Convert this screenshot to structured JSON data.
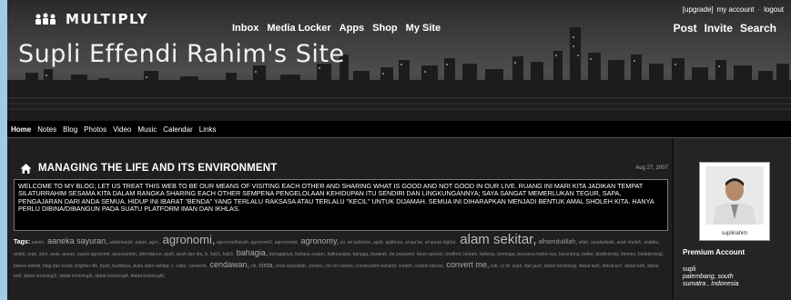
{
  "header": {
    "logo_text": "MULTIPLY",
    "site_title": "Supli Effendi Rahim's Site",
    "top_nav": [
      "Inbox",
      "Media Locker",
      "Apps",
      "Shop",
      "My Site"
    ],
    "account_links": [
      "[upgrade]",
      "my account",
      "logout"
    ],
    "account_sep": "·",
    "right_nav": [
      "Post",
      "Invite",
      "Search"
    ]
  },
  "sub_nav": [
    "Home",
    "Notes",
    "Blog",
    "Photos",
    "Video",
    "Music",
    "Calendar",
    "Links"
  ],
  "post": {
    "title": "MANAGING THE LIFE AND ITS ENVIRONMENT",
    "date": "Aug 27, 2007",
    "body": "WELCOME TO MY BLOG; LET US TREAT THIS WEB TO BE OUR MEANS OF VISITING EACH OTHER AND SHARING WHAT IS GOOD AND NOT GOOD IN OUR LIVE. RUANG INI MARI KITA JADIKAN TEMPAT SILATURRAHIM SESAMA KITA DALAM RANGKA SHARING EACH OTHER SEMPENA PENGELOLAAN KEHIDUPAN ITU SENDIRI DAN LINGKUNGANNYA; SAYA SANGAT MEMERLUKAN TEGUR, SAPA, PENGAJARAN DARI ANDA SEMUA. HIDUP INI IBARAT \"BENDA\" YANG TERLALU RAKSASA ATAU TERLALU \"KECIL\" UNTUK DIJAMAH. SEMUA INI DIHARAPKAN MENJADI BENTUK AMAL SHOLEH KITA. HANYA PERLU DIBINA/DIBANGUN PADA SUATU PLATFORM IMAN DAN IKHLAS.",
    "tags_label": "Tags:",
    "tags": [
      {
        "text": "aamin,",
        "w": 1
      },
      {
        "text": "aaneka sayuran,",
        "w": 3
      },
      {
        "text": "adabmasjid,",
        "w": 1
      },
      {
        "text": "adam,",
        "w": 1
      },
      {
        "text": "agro,",
        "w": 1
      },
      {
        "text": "agronomi,",
        "w": 4
      },
      {
        "text": "agronomi/tanah,",
        "w": 1
      },
      {
        "text": "agronomi2,",
        "w": 1
      },
      {
        "text": "agronomist,",
        "w": 1
      },
      {
        "text": "agronomy,",
        "w": 3
      },
      {
        "text": "air,",
        "w": 1
      },
      {
        "text": "air pollution,",
        "w": 1
      },
      {
        "text": "ajaib,",
        "w": 1
      },
      {
        "text": "ajaibnya,",
        "w": 1
      },
      {
        "text": "al-qur'an,",
        "w": 1
      },
      {
        "text": "al-quran digital,",
        "w": 1
      },
      {
        "text": "alam sekitar,",
        "w": 5
      },
      {
        "text": "alhamdulillah,",
        "w": 2
      },
      {
        "text": "allah,",
        "w": 1
      },
      {
        "text": "amalanbaik,",
        "w": 1
      },
      {
        "text": "anak sholeh,",
        "w": 1
      },
      {
        "text": "anakku,",
        "w": 1
      },
      {
        "text": "andal,",
        "w": 1
      },
      {
        "text": "arab,",
        "w": 1
      },
      {
        "text": "arini,",
        "w": 1
      },
      {
        "text": "asas,",
        "w": 1
      },
      {
        "text": "asean,",
        "w": 1
      },
      {
        "text": "aspek agronomi,",
        "w": 1
      },
      {
        "text": "assessment,",
        "w": 1
      },
      {
        "text": "attendance,",
        "w": 1
      },
      {
        "text": "ayah,",
        "w": 1
      },
      {
        "text": "ayah dan ibu,",
        "w": 1
      },
      {
        "text": "b,",
        "w": 1
      },
      {
        "text": "bab1,",
        "w": 1
      },
      {
        "text": "bab3,",
        "w": 1
      },
      {
        "text": "bahagia,",
        "w": 3
      },
      {
        "text": "bahagianya,",
        "w": 1
      },
      {
        "text": "bahasa soalan,",
        "w": 1
      },
      {
        "text": "baiksangka,",
        "w": 1
      },
      {
        "text": "bangga,",
        "w": 1
      },
      {
        "text": "barakah,",
        "w": 1
      },
      {
        "text": "be prepared,",
        "w": 1
      },
      {
        "text": "bean sprouts,",
        "w": 1
      },
      {
        "text": "bedford,",
        "w": 1
      },
      {
        "text": "bekam,",
        "w": 1
      },
      {
        "text": "bekerja,",
        "w": 1
      },
      {
        "text": "berniaga,",
        "w": 1
      },
      {
        "text": "bersama make-nya,",
        "w": 1
      },
      {
        "text": "beruntung,",
        "w": 1
      },
      {
        "text": "better,",
        "w": 1
      },
      {
        "text": "biodiversity,",
        "w": 1
      },
      {
        "text": "biomes,",
        "w": 1
      },
      {
        "text": "bioteknologi,",
        "w": 1
      },
      {
        "text": "bisnes ketedi,",
        "w": 1
      },
      {
        "text": "blog dan kelab,",
        "w": 1
      },
      {
        "text": "brighter life,",
        "w": 1
      },
      {
        "text": "bush,",
        "w": 1
      },
      {
        "text": "budidaya,",
        "w": 1
      },
      {
        "text": "buku alam sekitar,",
        "w": 1
      },
      {
        "text": "c,",
        "w": 1
      },
      {
        "text": "cabe,",
        "w": 1
      },
      {
        "text": "cameron,",
        "w": 1
      },
      {
        "text": "cendawan,",
        "w": 3
      },
      {
        "text": "cili,",
        "w": 1
      },
      {
        "text": "cinta,",
        "w": 2
      },
      {
        "text": "cinta rasulullah,",
        "w": 1
      },
      {
        "text": "cintaku,",
        "w": 1
      },
      {
        "text": "ciri-ciri sistem,",
        "w": 1
      },
      {
        "text": "constructed wetland,",
        "w": 1
      },
      {
        "text": "contoh,",
        "w": 1
      },
      {
        "text": "contoh tulisan,",
        "w": 1
      },
      {
        "text": "convert me,",
        "w": 3
      },
      {
        "text": "cuti,",
        "w": 1
      },
      {
        "text": "cv dr. supli,",
        "w": 1
      },
      {
        "text": "dari jauh,",
        "w": 1
      },
      {
        "text": "debat hrtistologi,",
        "w": 1
      },
      {
        "text": "debat kei6,",
        "w": 1
      },
      {
        "text": "debat ks7,",
        "w": 1
      },
      {
        "text": "debat ke8,",
        "w": 1
      },
      {
        "text": "debat ke9,",
        "w": 1
      },
      {
        "text": "debat kristologi2,",
        "w": 1
      },
      {
        "text": "debat kristologi3,",
        "w": 1
      },
      {
        "text": "debat kristologi4,",
        "w": 1
      },
      {
        "text": "debat kristologi6,",
        "w": 1
      }
    ]
  },
  "sidebar": {
    "avatar_caption": "supliirahim",
    "account_type": "Premium Account",
    "info": [
      "supli",
      "palembang, south",
      "sumatra , Indonesia"
    ]
  }
}
